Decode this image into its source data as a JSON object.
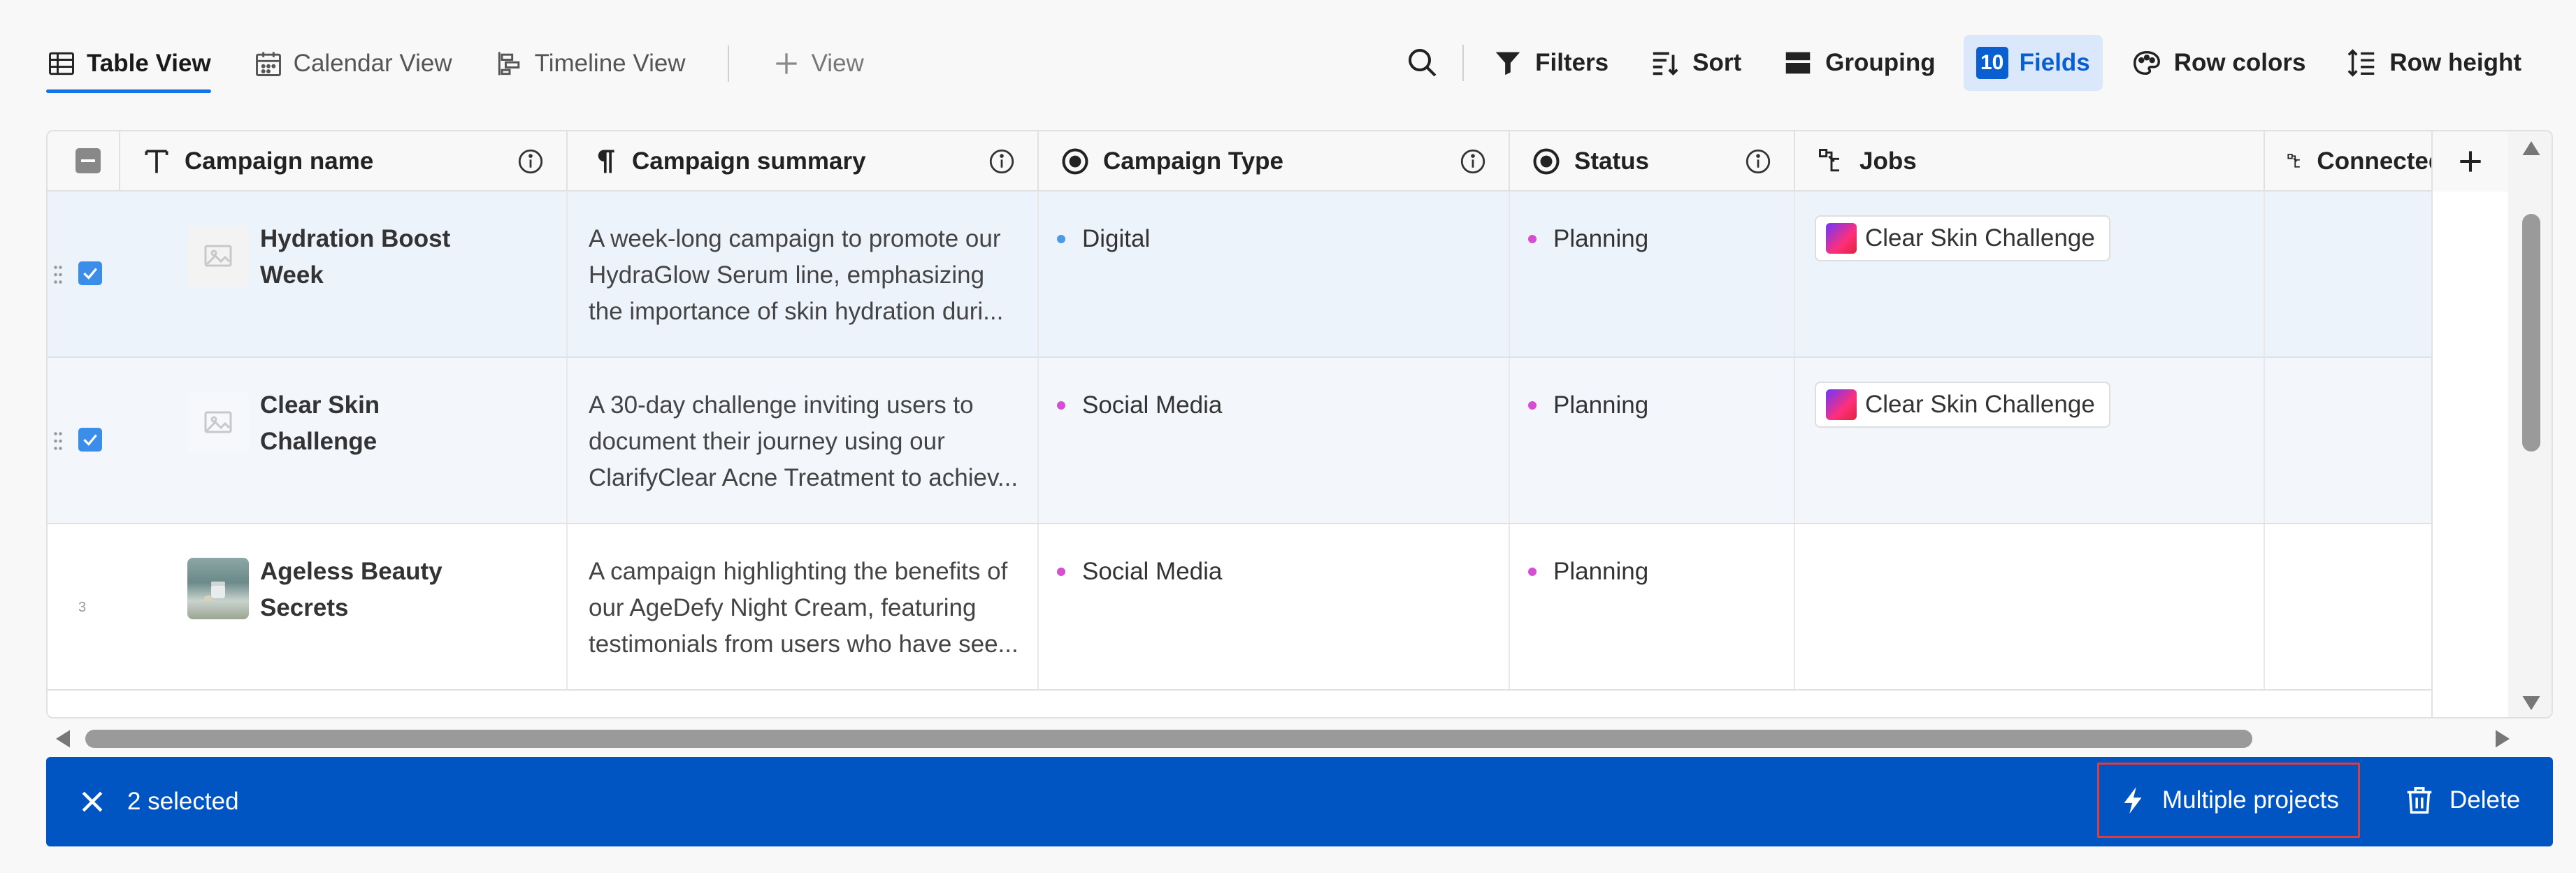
{
  "views": {
    "tabs": [
      {
        "label": "Table View",
        "active": true,
        "icon": "table-icon"
      },
      {
        "label": "Calendar View",
        "active": false,
        "icon": "calendar-icon"
      },
      {
        "label": "Timeline View",
        "active": false,
        "icon": "timeline-icon"
      }
    ],
    "add_view_label": "View"
  },
  "tools": {
    "filters": "Filters",
    "sort": "Sort",
    "grouping": "Grouping",
    "fields_count": "10",
    "fields": "Fields",
    "row_colors": "Row colors",
    "row_height": "Row height"
  },
  "columns": [
    {
      "label": "Campaign name",
      "icon": "text-type-icon",
      "info": true
    },
    {
      "label": "Campaign summary",
      "icon": "paragraph-icon",
      "info": true
    },
    {
      "label": "Campaign Type",
      "icon": "single-select-icon",
      "info": true
    },
    {
      "label": "Status",
      "icon": "single-select-icon",
      "info": true
    },
    {
      "label": "Jobs",
      "icon": "connection-icon",
      "info": false
    },
    {
      "label": "Connected pr",
      "icon": "connection-icon",
      "info": false
    }
  ],
  "rows": [
    {
      "name": "Hydration Boost Week",
      "summary": "A week-long campaign to promote our HydraGlow Serum line, emphasizing the importance of skin hydration duri...",
      "type": "Digital",
      "type_color": "#4a9be6",
      "status": "Planning",
      "status_color": "#d54fd2",
      "job": "Clear Skin Challenge",
      "selected": true
    },
    {
      "name": "Clear Skin Challenge",
      "summary": "A 30-day challenge inviting users to document their journey using our ClarifyClear Acne Treatment to achiev...",
      "type": "Social Media",
      "type_color": "#d54fd2",
      "status": "Planning",
      "status_color": "#d54fd2",
      "job": "Clear Skin Challenge",
      "selected": true
    },
    {
      "name": "Ageless Beauty Secrets",
      "summary": "A campaign highlighting the benefits of our AgeDefy Night Cream, featuring testimonials from users who have see...",
      "type": "Social Media",
      "type_color": "#d54fd2",
      "status": "Planning",
      "status_color": "#d54fd2",
      "job": "",
      "selected": false,
      "row_number": "3"
    }
  ],
  "action_bar": {
    "selected_text": "2 selected",
    "multiple_projects": "Multiple projects",
    "delete": "Delete"
  }
}
